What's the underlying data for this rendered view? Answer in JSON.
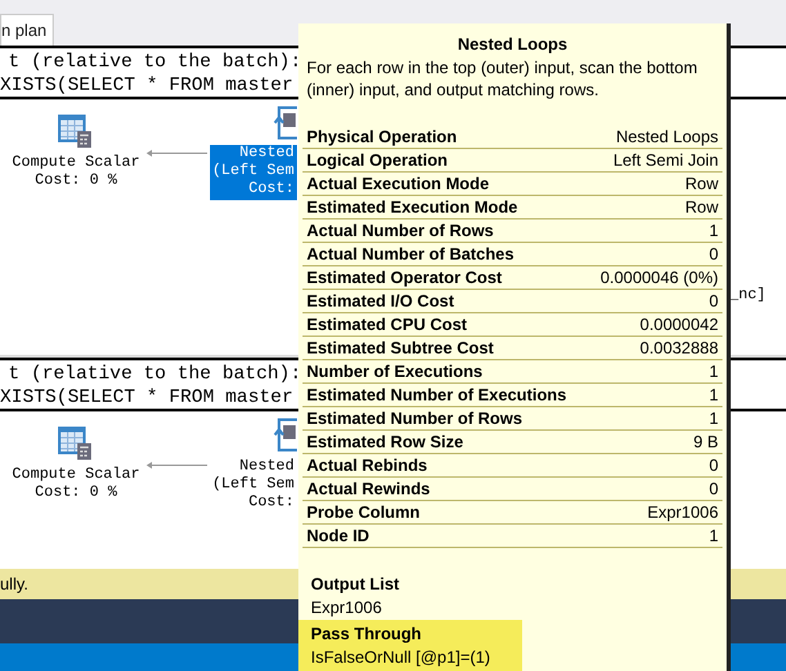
{
  "tab": {
    "label": "n plan",
    "selected": true
  },
  "statements": [
    {
      "header": [
        "t (relative to the batch):",
        "XISTS(SELECT * FROM master"
      ],
      "nodes": [
        {
          "kind": "compute",
          "lines": [
            "Compute Scalar",
            "Cost: 0 %"
          ],
          "selected": false
        },
        {
          "kind": "loop",
          "lines": [
            "Nested",
            "(Left Sem",
            "Cost:"
          ],
          "selected": true
        }
      ],
      "fragment": "_nc]"
    },
    {
      "header": [
        "t (relative to the batch):",
        "XISTS(SELECT * FROM master"
      ],
      "nodes": [
        {
          "kind": "compute",
          "lines": [
            "Compute Scalar",
            "Cost: 0 %"
          ],
          "selected": false
        },
        {
          "kind": "loop",
          "lines": [
            "Nested",
            "(Left Sem",
            "Cost:"
          ],
          "selected": false
        }
      ]
    }
  ],
  "status_bar": "ully.",
  "tooltip": {
    "title": "Nested Loops",
    "description": "For each row in the top (outer) input, scan the bottom (inner) input, and output matching rows.",
    "properties": [
      {
        "name": "Physical Operation",
        "value": "Nested Loops"
      },
      {
        "name": "Logical Operation",
        "value": "Left Semi Join"
      },
      {
        "name": "Actual Execution Mode",
        "value": "Row"
      },
      {
        "name": "Estimated Execution Mode",
        "value": "Row"
      },
      {
        "name": "Actual Number of Rows",
        "value": "1"
      },
      {
        "name": "Actual Number of Batches",
        "value": "0"
      },
      {
        "name": "Estimated Operator Cost",
        "value": "0.0000046 (0%)"
      },
      {
        "name": "Estimated I/O Cost",
        "value": "0"
      },
      {
        "name": "Estimated CPU Cost",
        "value": "0.0000042"
      },
      {
        "name": "Estimated Subtree Cost",
        "value": "0.0032888"
      },
      {
        "name": "Number of Executions",
        "value": "1"
      },
      {
        "name": "Estimated Number of Executions",
        "value": "1"
      },
      {
        "name": "Estimated Number of Rows",
        "value": "1"
      },
      {
        "name": "Estimated Row Size",
        "value": "9 B"
      },
      {
        "name": "Actual Rebinds",
        "value": "0"
      },
      {
        "name": "Actual Rewinds",
        "value": "0"
      },
      {
        "name": "Probe Column",
        "value": "Expr1006"
      },
      {
        "name": "Node ID",
        "value": "1"
      }
    ],
    "sections": [
      {
        "heading": "Output List",
        "value": "Expr1006",
        "highlighted": false
      },
      {
        "heading": "Pass Through",
        "value": "IsFalseOrNull [@p1]=(1)",
        "highlighted": true
      }
    ]
  }
}
